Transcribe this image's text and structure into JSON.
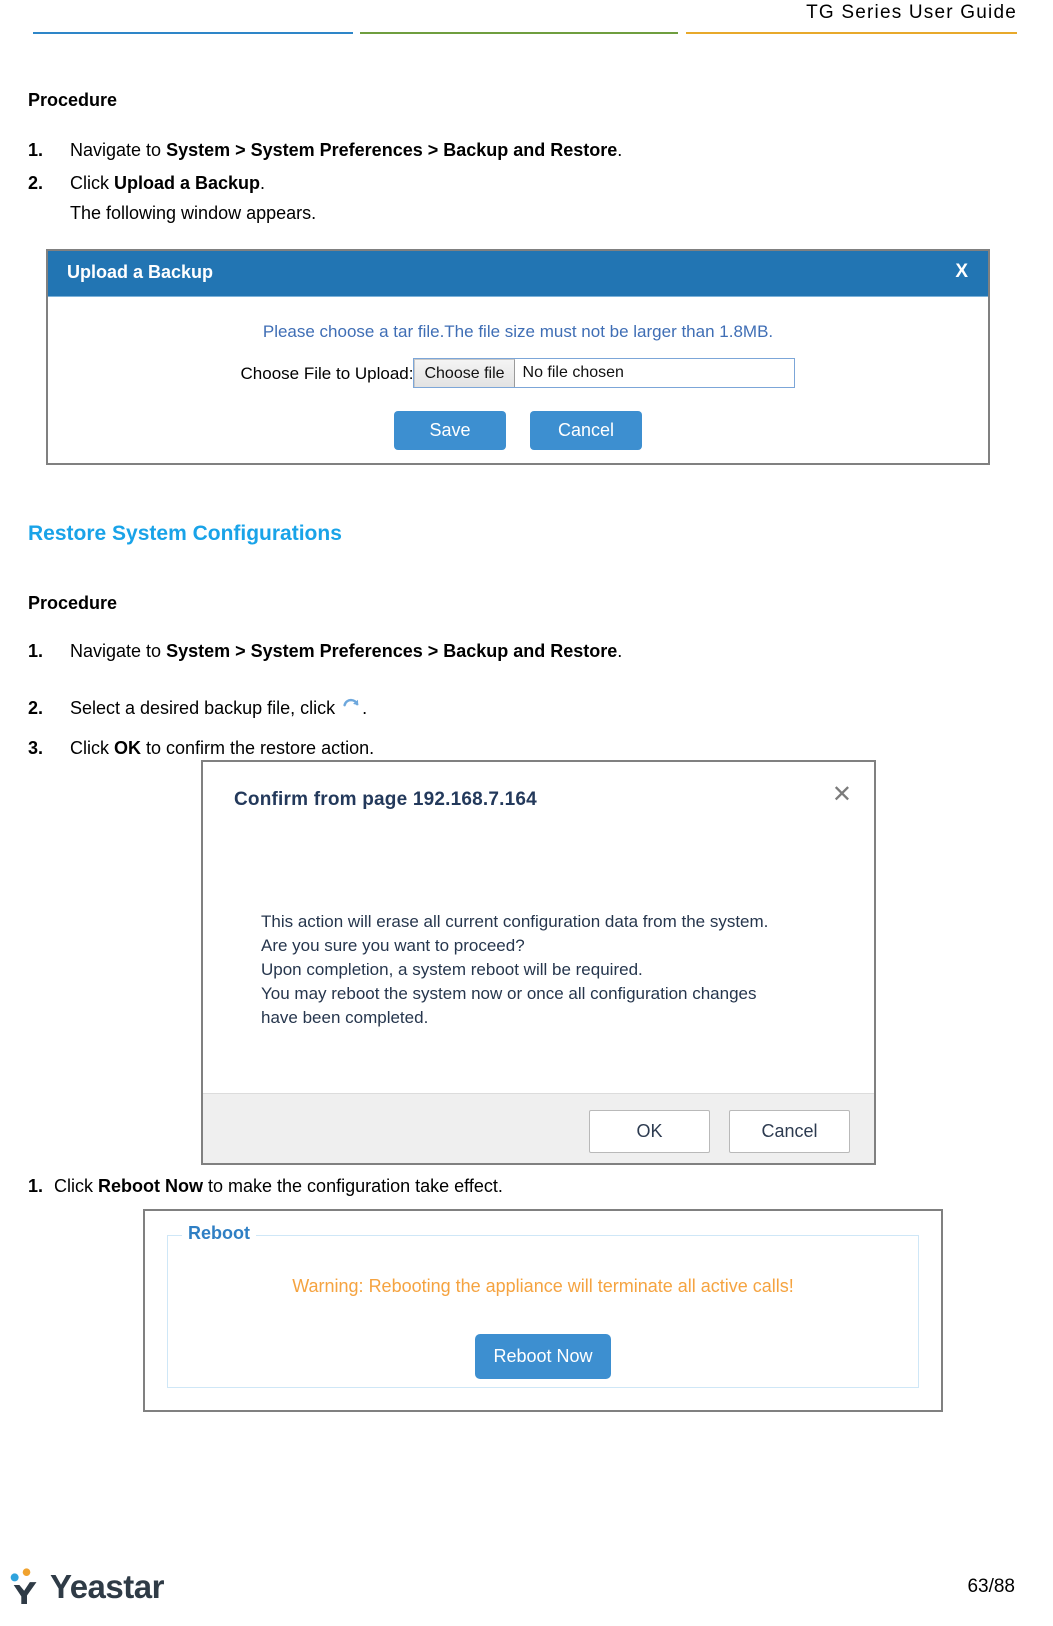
{
  "header": {
    "title": "TG  Series  User  Guide",
    "rule_colors": {
      "blue": "#2e86c8",
      "green": "#6f9e3f",
      "orange": "#e8a92b"
    }
  },
  "section_one": {
    "procedure_heading": "Procedure",
    "steps": [
      {
        "num": "1.",
        "prefix": "Navigate  to ",
        "bold": "System > System Preferences > Backup and Restore",
        "suffix": "."
      },
      {
        "num": "2.",
        "prefix": "Click ",
        "bold": "Upload a Backup",
        "suffix": "."
      }
    ],
    "sub_line": "The following  window appears."
  },
  "upload_dialog": {
    "title": "Upload a Backup",
    "close_label": "X",
    "note": "Please choose a tar file.The file size must not be larger than 1.8MB.",
    "field_label": "Choose File to Upload:",
    "choose_file_button": "Choose file",
    "file_name": "No file chosen",
    "save_button": "Save",
    "cancel_button": "Cancel"
  },
  "section_two": {
    "heading": "Restore System Configurations",
    "heading_color": "#19a3e8",
    "procedure_heading": "Procedure",
    "steps": [
      {
        "num": "1.",
        "prefix": "Navigate  to ",
        "bold": "System > System Preferences > Backup and Restore",
        "suffix": "."
      },
      {
        "num": "2.",
        "prefix": "Select a desired backup file,  click ",
        "bold": "",
        "suffix": "."
      },
      {
        "num": "3.",
        "prefix": "Click ",
        "bold": "OK",
        "suffix": " to confirm the restore action."
      }
    ],
    "restore_icon": "refresh-icon"
  },
  "confirm_dialog": {
    "title": "Confirm from page 192.168.7.164",
    "close_label": "✕",
    "message_lines": [
      "This action will erase all current configuration data from the system.",
      "Are you sure you want to proceed?",
      "Upon completion, a system reboot will be required.",
      "You may reboot the system now or once all configuration changes",
      "have been completed."
    ],
    "ok_button": "OK",
    "cancel_button": "Cancel"
  },
  "section_three": {
    "step": {
      "num": "1.",
      "prefix": "Click ",
      "bold": "Reboot Now",
      "suffix": " to make the configuration take effect."
    }
  },
  "reboot_panel": {
    "legend": "Reboot",
    "warning": "Warning: Rebooting the appliance will terminate all active calls!",
    "warning_color": "#f5a340",
    "reboot_button": "Reboot Now"
  },
  "footer": {
    "brand": "Yeastar",
    "page_number": "63/88"
  }
}
